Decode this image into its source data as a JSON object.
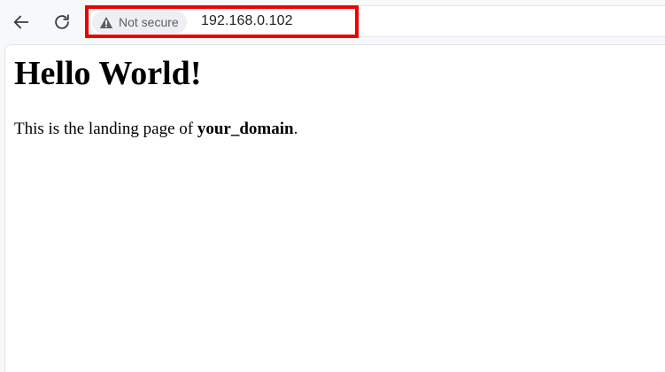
{
  "browser": {
    "security_label": "Not secure",
    "url": "192.168.0.102",
    "icons": {
      "back": "arrow-left-icon",
      "reload": "reload-icon",
      "security": "warning-triangle-icon"
    },
    "highlight_color": "#ee0000"
  },
  "page": {
    "heading": "Hello World!",
    "paragraph_prefix": "This is the landing page of ",
    "paragraph_bold": "your_domain",
    "paragraph_suffix": "."
  }
}
